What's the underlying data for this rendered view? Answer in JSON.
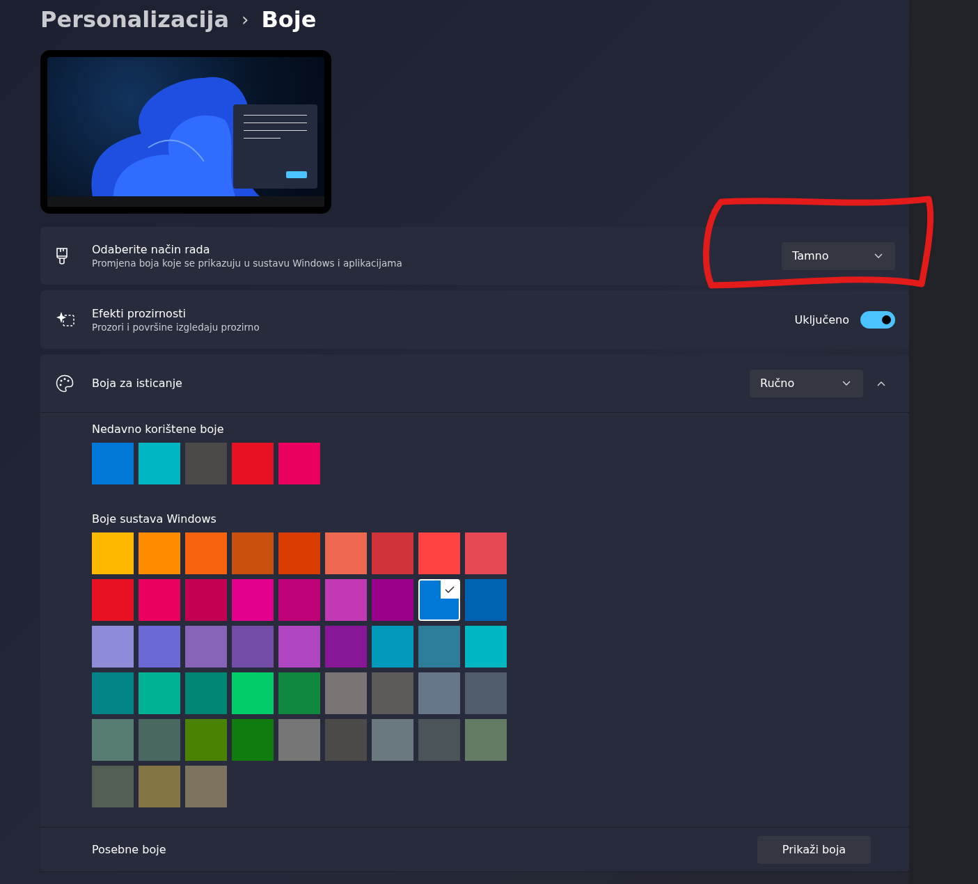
{
  "breadcrumb": {
    "parent": "Personalizacija",
    "separator": "›",
    "current": "Boje"
  },
  "settings": [
    {
      "kind": "dropdown",
      "title": "Odaberite način rada",
      "subtitle": "Promjena boja koje se prikazuju u sustavu Windows i aplikacijama",
      "value": "Tamno"
    },
    {
      "kind": "toggle",
      "title": "Efekti prozirnosti",
      "subtitle": "Prozori i površine izgledaju prozirno",
      "state_label": "Uključeno",
      "on": true
    }
  ],
  "accent": {
    "title": "Boja za isticanje",
    "value": "Ručno",
    "expanded": true,
    "recent_title": "Nedavno korištene boje",
    "recent": [
      {
        "color": "#0078d7"
      },
      {
        "color": "#00b7c3"
      },
      {
        "color": "#4c4a48"
      },
      {
        "color": "#e81123"
      },
      {
        "color": "#ea005e"
      }
    ],
    "windows_title": "Boje sustava Windows",
    "windows": [
      {
        "color": "#ffb900",
        "selected": false
      },
      {
        "color": "#ff8c00",
        "selected": false
      },
      {
        "color": "#f7630c",
        "selected": false
      },
      {
        "color": "#ca5010",
        "selected": false
      },
      {
        "color": "#da3b01",
        "selected": false
      },
      {
        "color": "#ef6950",
        "selected": false
      },
      {
        "color": "#d13438",
        "selected": false
      },
      {
        "color": "#ff4343",
        "selected": false
      },
      {
        "color": "#e74856",
        "selected": false
      },
      {
        "color": "#e81123",
        "selected": false
      },
      {
        "color": "#ea005e",
        "selected": false
      },
      {
        "color": "#c30052",
        "selected": false
      },
      {
        "color": "#e3008c",
        "selected": false
      },
      {
        "color": "#bf0077",
        "selected": false
      },
      {
        "color": "#c239b3",
        "selected": false
      },
      {
        "color": "#9a0089",
        "selected": false
      },
      {
        "color": "#0078d7",
        "selected": true
      },
      {
        "color": "#0063b1",
        "selected": false
      },
      {
        "color": "#8e8cd8",
        "selected": false
      },
      {
        "color": "#6b69d6",
        "selected": false
      },
      {
        "color": "#8764b8",
        "selected": false
      },
      {
        "color": "#744da9",
        "selected": false
      },
      {
        "color": "#b146c2",
        "selected": false
      },
      {
        "color": "#881798",
        "selected": false
      },
      {
        "color": "#0099bc",
        "selected": false
      },
      {
        "color": "#2d7d9a",
        "selected": false
      },
      {
        "color": "#00b7c3",
        "selected": false
      },
      {
        "color": "#038387",
        "selected": false
      },
      {
        "color": "#00b294",
        "selected": false
      },
      {
        "color": "#018574",
        "selected": false
      },
      {
        "color": "#00cc6a",
        "selected": false
      },
      {
        "color": "#10893e",
        "selected": false
      },
      {
        "color": "#7a7574",
        "selected": false
      },
      {
        "color": "#5d5a58",
        "selected": false
      },
      {
        "color": "#68768a",
        "selected": false
      },
      {
        "color": "#515c6b",
        "selected": false
      },
      {
        "color": "#567c73",
        "selected": false
      },
      {
        "color": "#486860",
        "selected": false
      },
      {
        "color": "#498205",
        "selected": false
      },
      {
        "color": "#107c10",
        "selected": false
      },
      {
        "color": "#767676",
        "selected": false
      },
      {
        "color": "#4c4a48",
        "selected": false
      },
      {
        "color": "#69797e",
        "selected": false
      },
      {
        "color": "#4a5459",
        "selected": false
      },
      {
        "color": "#647c64",
        "selected": false
      },
      {
        "color": "#525e54",
        "selected": false
      },
      {
        "color": "#847545",
        "selected": false
      },
      {
        "color": "#7e735f",
        "selected": false
      }
    ],
    "custom_label": "Posebne boje",
    "custom_button": "Prikaži boja"
  }
}
